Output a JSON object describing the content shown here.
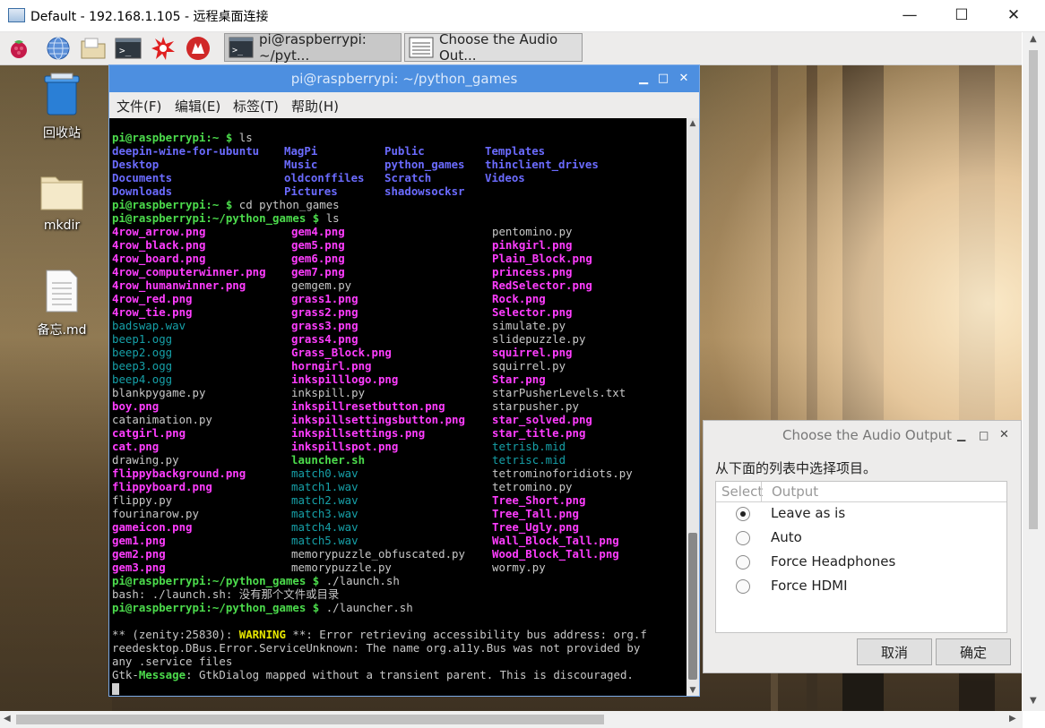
{
  "window": {
    "title": "Default - 192.168.1.105 - 远程桌面连接",
    "minimize_glyph": "—",
    "maximize_glyph": "☐",
    "close_glyph": "✕"
  },
  "panel": {
    "icons": [
      "raspberry-menu-icon",
      "web-browser-icon",
      "file-manager-icon",
      "terminal-icon",
      "wolfram-icon",
      "mathematica-icon"
    ],
    "tasks": [
      {
        "label": "pi@raspberrypi: ~/pyt...",
        "icon": "terminal-icon"
      },
      {
        "label": "Choose the Audio Out...",
        "icon": "list-window-icon"
      }
    ]
  },
  "desktop_icons": [
    {
      "label": "回收站",
      "icon": "trash-icon"
    },
    {
      "label": "mkdir",
      "icon": "folder-icon"
    },
    {
      "label": "备忘.md",
      "icon": "document-icon"
    }
  ],
  "terminal": {
    "title": "pi@raspberrypi: ~/python_games",
    "controls": {
      "minimize": "▁",
      "maximize": "□",
      "close": "✕"
    },
    "menu": [
      "文件(F)",
      "编辑(E)",
      "标签(T)",
      "帮助(H)"
    ],
    "prompt_home": "pi@raspberrypi:~ $ ",
    "prompt_games": "pi@raspberrypi:~/python_games $ ",
    "cmd_ls": "ls",
    "cmd_cd": "cd python_games",
    "ls_home": [
      [
        "deepin-wine-for-ubuntu",
        "MagPi",
        "Public",
        "Templates"
      ],
      [
        "Desktop",
        "Music",
        "python_games",
        "thinclient_drives"
      ],
      [
        "Documents",
        "oldconffiles",
        "Scratch",
        "Videos"
      ],
      [
        "Downloads",
        "Pictures",
        "shadowsocksr",
        ""
      ]
    ],
    "ls_games": [
      [
        [
          "4row_arrow.png",
          "m"
        ],
        [
          "gem4.png",
          "m"
        ],
        [
          "pentomino.py",
          "w"
        ]
      ],
      [
        [
          "4row_black.png",
          "m"
        ],
        [
          "gem5.png",
          "m"
        ],
        [
          "pinkgirl.png",
          "m"
        ]
      ],
      [
        [
          "4row_board.png",
          "m"
        ],
        [
          "gem6.png",
          "m"
        ],
        [
          "Plain_Block.png",
          "m"
        ]
      ],
      [
        [
          "4row_computerwinner.png",
          "m"
        ],
        [
          "gem7.png",
          "m"
        ],
        [
          "princess.png",
          "m"
        ]
      ],
      [
        [
          "4row_humanwinner.png",
          "m"
        ],
        [
          "gemgem.py",
          "w"
        ],
        [
          "RedSelector.png",
          "m"
        ]
      ],
      [
        [
          "4row_red.png",
          "m"
        ],
        [
          "grass1.png",
          "m"
        ],
        [
          "Rock.png",
          "m"
        ]
      ],
      [
        [
          "4row_tie.png",
          "m"
        ],
        [
          "grass2.png",
          "m"
        ],
        [
          "Selector.png",
          "m"
        ]
      ],
      [
        [
          "badswap.wav",
          "c"
        ],
        [
          "grass3.png",
          "m"
        ],
        [
          "simulate.py",
          "w"
        ]
      ],
      [
        [
          "beep1.ogg",
          "c"
        ],
        [
          "grass4.png",
          "m"
        ],
        [
          "slidepuzzle.py",
          "w"
        ]
      ],
      [
        [
          "beep2.ogg",
          "c"
        ],
        [
          "Grass_Block.png",
          "m"
        ],
        [
          "squirrel.png",
          "m"
        ]
      ],
      [
        [
          "beep3.ogg",
          "c"
        ],
        [
          "horngirl.png",
          "m"
        ],
        [
          "squirrel.py",
          "w"
        ]
      ],
      [
        [
          "beep4.ogg",
          "c"
        ],
        [
          "inkspilllogo.png",
          "m"
        ],
        [
          "Star.png",
          "m"
        ]
      ],
      [
        [
          "blankpygame.py",
          "w"
        ],
        [
          "inkspill.py",
          "w"
        ],
        [
          "starPusherLevels.txt",
          "w"
        ]
      ],
      [
        [
          "boy.png",
          "m"
        ],
        [
          "inkspillresetbutton.png",
          "m"
        ],
        [
          "starpusher.py",
          "w"
        ]
      ],
      [
        [
          "catanimation.py",
          "w"
        ],
        [
          "inkspillsettingsbutton.png",
          "m"
        ],
        [
          "star_solved.png",
          "m"
        ]
      ],
      [
        [
          "catgirl.png",
          "m"
        ],
        [
          "inkspillsettings.png",
          "m"
        ],
        [
          "star_title.png",
          "m"
        ]
      ],
      [
        [
          "cat.png",
          "m"
        ],
        [
          "inkspillspot.png",
          "m"
        ],
        [
          "tetrisb.mid",
          "c"
        ]
      ],
      [
        [
          "drawing.py",
          "w"
        ],
        [
          "launcher.sh",
          "lg"
        ],
        [
          "tetrisc.mid",
          "c"
        ]
      ],
      [
        [
          "flippybackground.png",
          "m"
        ],
        [
          "match0.wav",
          "c"
        ],
        [
          "tetrominoforidiots.py",
          "w"
        ]
      ],
      [
        [
          "flippyboard.png",
          "m"
        ],
        [
          "match1.wav",
          "c"
        ],
        [
          "tetromino.py",
          "w"
        ]
      ],
      [
        [
          "flippy.py",
          "w"
        ],
        [
          "match2.wav",
          "c"
        ],
        [
          "Tree_Short.png",
          "m"
        ]
      ],
      [
        [
          "fourinarow.py",
          "w"
        ],
        [
          "match3.wav",
          "c"
        ],
        [
          "Tree_Tall.png",
          "m"
        ]
      ],
      [
        [
          "gameicon.png",
          "m"
        ],
        [
          "match4.wav",
          "c"
        ],
        [
          "Tree_Ugly.png",
          "m"
        ]
      ],
      [
        [
          "gem1.png",
          "m"
        ],
        [
          "match5.wav",
          "c"
        ],
        [
          "Wall_Block_Tall.png",
          "m"
        ]
      ],
      [
        [
          "gem2.png",
          "m"
        ],
        [
          "memorypuzzle_obfuscated.py",
          "w"
        ],
        [
          "Wood_Block_Tall.png",
          "m"
        ]
      ],
      [
        [
          "gem3.png",
          "m"
        ],
        [
          "memorypuzzle.py",
          "w"
        ],
        [
          "wormy.py",
          "w"
        ]
      ]
    ],
    "cmd_launch": "./launch.sh",
    "bash_error": "bash: ./launch.sh: 没有那个文件或目录",
    "cmd_launcher": "./launcher.sh",
    "zenity_pre": "** (zenity:25830): ",
    "zenity_warning": "WARNING",
    "zenity_msg1": " **: Error retrieving accessibility bus address: org.f",
    "zenity_msg2": "reedesktop.DBus.Error.ServiceUnknown: The name org.a11y.Bus was not provided by",
    "zenity_msg3": "any .service files",
    "gtk_prefix": "Gtk-",
    "gtk_message": "Message",
    "gtk_text": ": GtkDialog mapped without a transient parent. This is discouraged."
  },
  "dialog": {
    "title": "Choose the Audio Output",
    "controls": {
      "minimize": "▁",
      "maximize": "□",
      "close": "✕"
    },
    "prompt": "从下面的列表中选择项目。",
    "col_select": "Select",
    "col_output": "Output",
    "options": [
      "Leave as is",
      "Auto",
      "Force Headphones",
      "Force HDMI"
    ],
    "selected_index": 0,
    "cancel": "取消",
    "ok": "确定"
  },
  "colors": {
    "term_titlebar": "#4d8fe0",
    "prompt_green": "#4cdc4c",
    "dir_blue": "#6b6bff",
    "image_magenta": "#ff3dff",
    "audio_cyan": "#16a0a8",
    "warning_yellow": "#e8e800"
  }
}
